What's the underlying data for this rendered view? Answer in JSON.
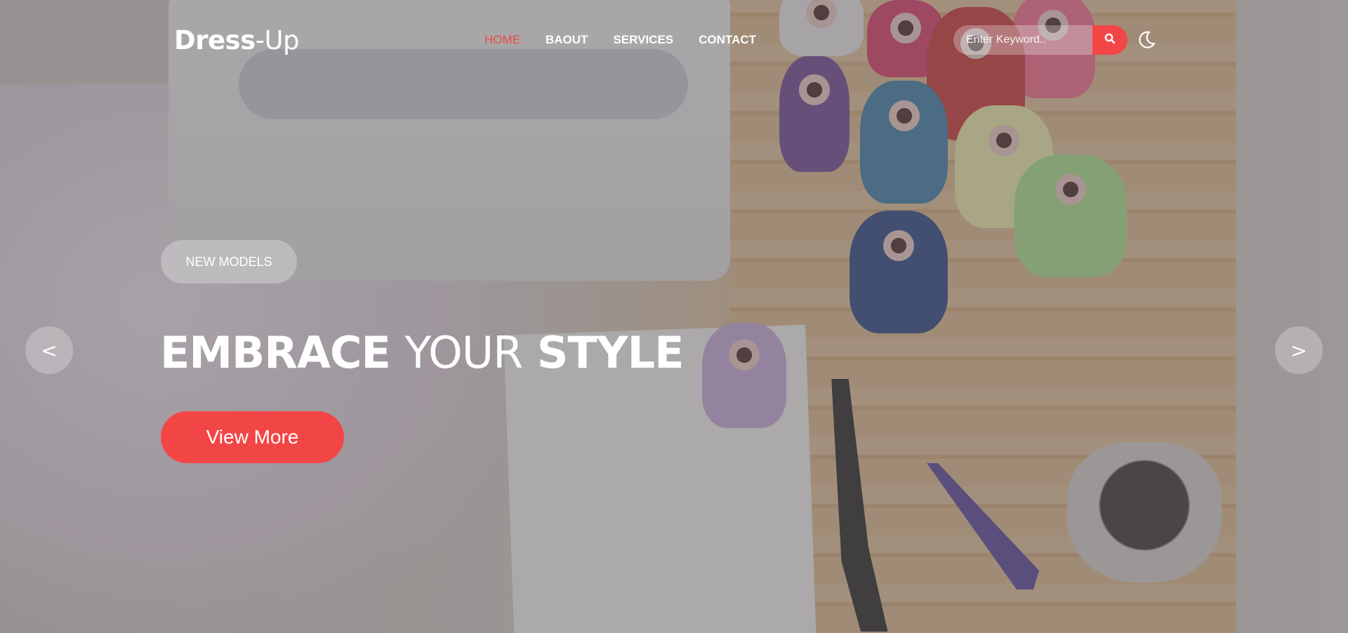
{
  "header": {
    "logo_bold": "Dress",
    "logo_light": "-Up",
    "nav": [
      {
        "label": "HOME",
        "active": true
      },
      {
        "label": "BAOUT",
        "active": false
      },
      {
        "label": "SERVICES",
        "active": false
      },
      {
        "label": "CONTACT",
        "active": false
      }
    ],
    "search": {
      "placeholder": "Enter Keyword..",
      "value": ""
    },
    "search_button_icon": "search-icon",
    "theme_toggle_icon": "moon-icon"
  },
  "hero": {
    "badge": "NEW MODELS",
    "headline_part1": "EMBRACE",
    "headline_part2": "YOUR",
    "headline_part3": "STYLE",
    "cta_label": "View More",
    "prev_label": "<",
    "next_label": ">"
  },
  "colors": {
    "accent": "#f24646",
    "nav_active": "#f04a4a",
    "text": "#ffffff"
  }
}
